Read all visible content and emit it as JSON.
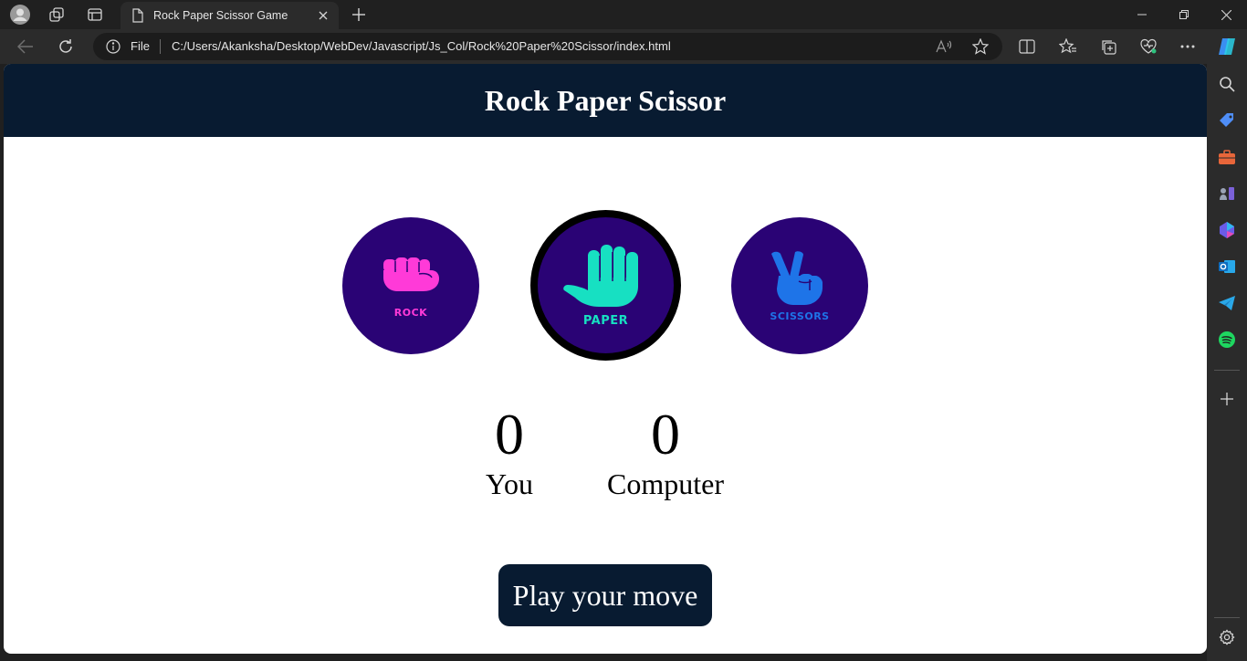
{
  "browser": {
    "tab_title": "Rock Paper Scissor Game",
    "address_scheme": "File",
    "address_url": "C:/Users/Akanksha/Desktop/WebDev/Javascript/Js_Col/Rock%20Paper%20Scissor/index.html"
  },
  "page": {
    "title": "Rock Paper Scissor",
    "choices": [
      {
        "id": "rock",
        "label": "ROCK",
        "color": "#ff3ad8",
        "selected": false
      },
      {
        "id": "paper",
        "label": "PAPER",
        "color": "#17e0c2",
        "selected": true
      },
      {
        "id": "scissors",
        "label": "SCISSORS",
        "color": "#1e74e8",
        "selected": false
      }
    ],
    "scores": {
      "user": {
        "value": "0",
        "label": "You"
      },
      "computer": {
        "value": "0",
        "label": "Computer"
      }
    },
    "message": "Play your move"
  },
  "colors": {
    "header_bg": "#081b31",
    "choice_bg": "#2a0375",
    "selected_border": "#000000"
  }
}
